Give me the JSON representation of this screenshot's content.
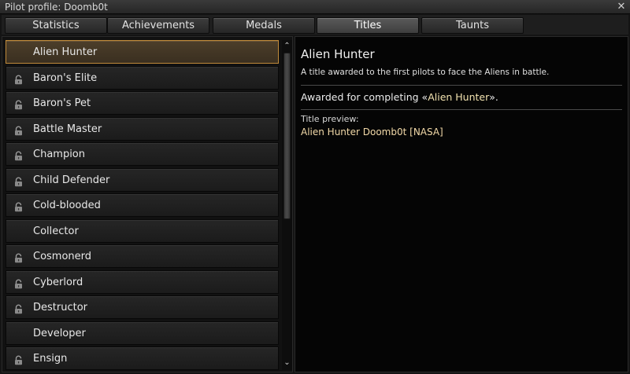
{
  "window": {
    "title": "Pilot profile: Doomb0t",
    "close_glyph": "✕",
    "close_icon": "close-icon"
  },
  "tabs": [
    {
      "label": "Statistics",
      "active": false
    },
    {
      "label": "Achievements",
      "active": false
    },
    {
      "label": "Medals",
      "active": false
    },
    {
      "label": "Titles",
      "active": true
    },
    {
      "label": "Taunts",
      "active": false
    }
  ],
  "titles_list": [
    {
      "label": "Alien Hunter",
      "locked": false,
      "selected": true
    },
    {
      "label": "Baron's Elite",
      "locked": true,
      "selected": false
    },
    {
      "label": "Baron's Pet",
      "locked": true,
      "selected": false
    },
    {
      "label": "Battle Master",
      "locked": true,
      "selected": false
    },
    {
      "label": "Champion",
      "locked": true,
      "selected": false
    },
    {
      "label": "Child Defender",
      "locked": true,
      "selected": false
    },
    {
      "label": "Cold-blooded",
      "locked": true,
      "selected": false
    },
    {
      "label": "Collector",
      "locked": false,
      "selected": false
    },
    {
      "label": "Cosmonerd",
      "locked": true,
      "selected": false
    },
    {
      "label": "Cyberlord",
      "locked": true,
      "selected": false
    },
    {
      "label": "Destructor",
      "locked": true,
      "selected": false
    },
    {
      "label": "Developer",
      "locked": false,
      "selected": false
    },
    {
      "label": "Ensign",
      "locked": true,
      "selected": false
    }
  ],
  "scrollbar": {
    "up_glyph": "⌃",
    "down_glyph": "⌄"
  },
  "detail": {
    "title": "Alien Hunter",
    "description": "A title awarded to the first pilots to face the Aliens in battle.",
    "awarded_prefix": "Awarded for completing «",
    "awarded_link": "Alien Hunter",
    "awarded_suffix": "».",
    "preview_label": "Title preview:",
    "preview_value": "Alien Hunter Doomb0t [NASA]"
  },
  "colors": {
    "accent_gold": "#f2d9a8",
    "selected_border": "#c08a3a"
  }
}
